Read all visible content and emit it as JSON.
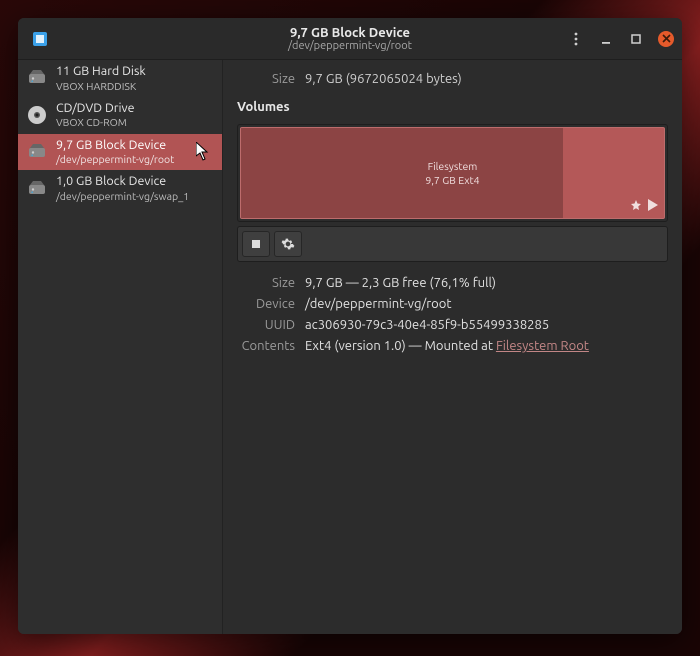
{
  "header": {
    "title": "9,7 GB Block Device",
    "subtitle": "/dev/peppermint-vg/root"
  },
  "sidebar": {
    "items": [
      {
        "label": "11 GB Hard Disk",
        "sub": "VBOX HARDDISK",
        "icon": "disk"
      },
      {
        "label": "CD/DVD Drive",
        "sub": "VBOX CD-ROM",
        "icon": "disc"
      },
      {
        "label": "9,7 GB Block Device",
        "sub": "/dev/peppermint-vg/root",
        "icon": "disk",
        "selected": true
      },
      {
        "label": "1,0 GB Block Device",
        "sub": "/dev/peppermint-vg/swap_1",
        "icon": "disk"
      }
    ]
  },
  "overview": {
    "size_label": "Size",
    "size_value": "9,7 GB (9672065024 bytes)",
    "volumes_title": "Volumes"
  },
  "volume": {
    "label_line1": "Filesystem",
    "label_line2": "9,7 GB Ext4",
    "used_pct": 76.1
  },
  "details": {
    "rows": [
      {
        "k": "Size",
        "v": "9,7 GB — 2,3 GB free (76,1% full)"
      },
      {
        "k": "Device",
        "v": "/dev/peppermint-vg/root"
      },
      {
        "k": "UUID",
        "v": "ac306930-79c3-40e4-85f9-b55499338285"
      }
    ],
    "contents_key": "Contents",
    "contents_prefix": "Ext4 (version 1.0) — Mounted at ",
    "contents_link": "Filesystem Root"
  },
  "colors": {
    "selection": "#b15454",
    "volume": "#b45858",
    "close": "#e55a2b"
  }
}
